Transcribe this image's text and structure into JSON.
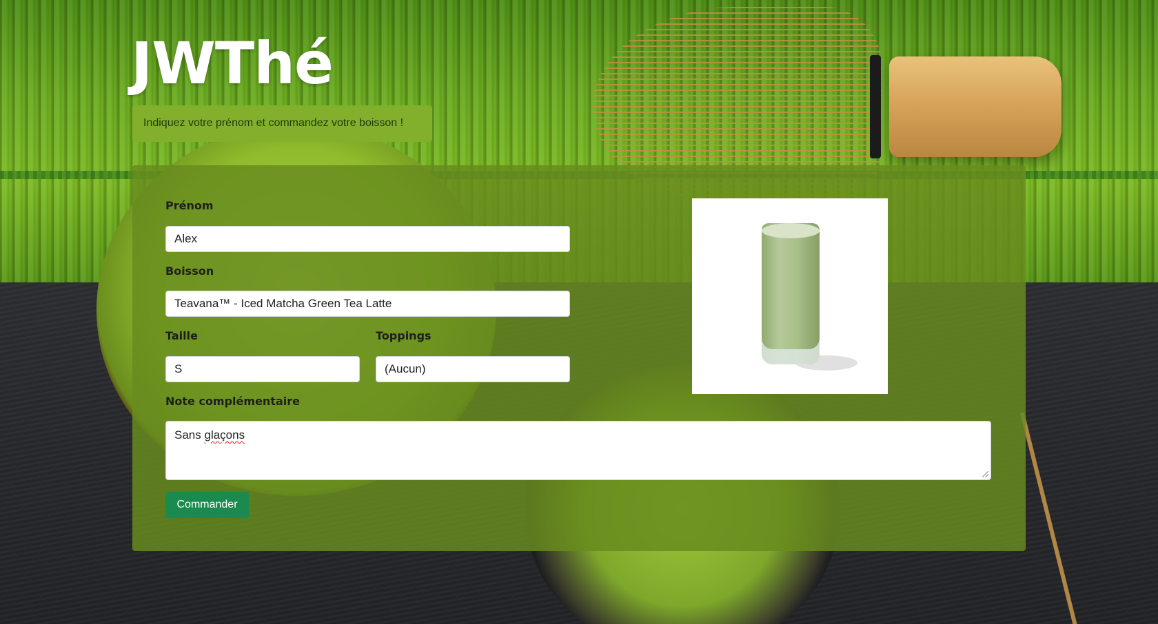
{
  "header": {
    "title": "JWThé",
    "alert": "Indiquez votre prénom et commandez votre boisson !"
  },
  "form": {
    "prenom": {
      "label": "Prénom",
      "value": "Alex"
    },
    "boisson": {
      "label": "Boisson",
      "value": "Teavana™ - Iced Matcha Green Tea Latte"
    },
    "taille": {
      "label": "Taille",
      "value": "S"
    },
    "toppings": {
      "label": "Toppings",
      "value": "(Aucun)"
    },
    "note": {
      "label": "Note complémentaire",
      "value_word1": "Sans",
      "value_word2": "glaçons"
    },
    "submit_label": "Commander"
  },
  "colors": {
    "alert_bg": "#82b02c",
    "panel_bg": "#688c1e",
    "button_bg": "#1b8a4f"
  }
}
